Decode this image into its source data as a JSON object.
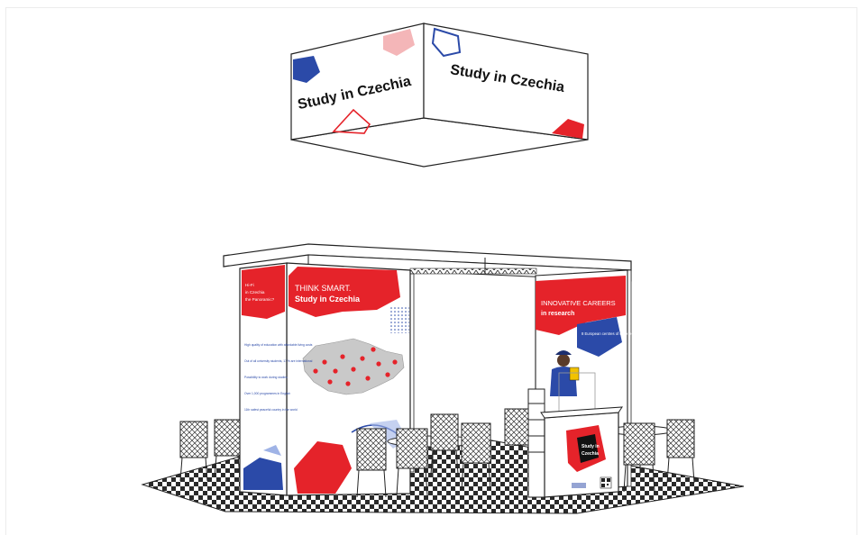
{
  "colors": {
    "brand_red": "#e5232a",
    "brand_blue": "#2b4aa8",
    "light_blue": "#9fb3e6",
    "pink": "#f4b6b8",
    "line": "#222222",
    "map_grey": "#c9c9c9"
  },
  "banner": {
    "left_text": "Study in Czechia",
    "right_text": "Study in Czechia"
  },
  "booth": {
    "left_panel": {
      "title_lines": [
        "Hi-Fi",
        "in Czechia",
        "the Panoramic?"
      ],
      "bullets": [
        "High quality of education with affordable living costs",
        "Out of all university students, 17 % are international",
        "Possibility to work during studies",
        "Over 1,000 programmes in English",
        "11th safest peaceful country in the world"
      ]
    },
    "center_panel": {
      "headline": "THINK SMART.",
      "subheadline": "Study in Czechia"
    },
    "right_panel": {
      "headline": "INNOVATIVE CAREERS",
      "subheadline": "in research",
      "bubble_text": "8 European centres of excellence"
    },
    "counter": {
      "logo_line1": "Study in",
      "logo_line2": "Czechia"
    }
  },
  "icons": [
    "person-icon",
    "qr-code-icon",
    "chair-icon",
    "map-icon"
  ]
}
